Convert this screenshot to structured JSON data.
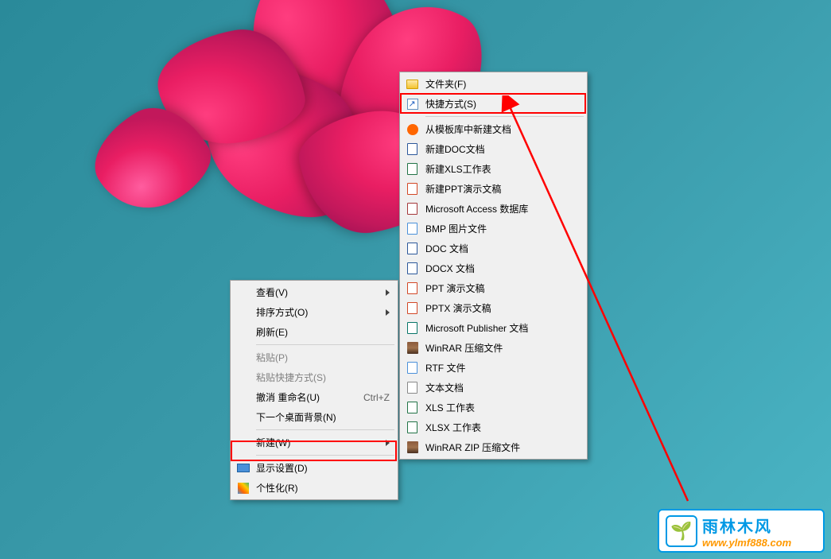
{
  "context_menu": {
    "view": "查看(V)",
    "sort": "排序方式(O)",
    "refresh": "刷新(E)",
    "paste": "粘贴(P)",
    "paste_shortcut": "粘贴快捷方式(S)",
    "undo": "撤消 重命名(U)",
    "undo_key": "Ctrl+Z",
    "next_bg": "下一个桌面背景(N)",
    "new": "新建(W)",
    "display": "显示设置(D)",
    "personalize": "个性化(R)"
  },
  "new_submenu": {
    "folder": "文件夹(F)",
    "shortcut": "快捷方式(S)",
    "template": "从模板库中新建文档",
    "doc": "新建DOC文档",
    "xls": "新建XLS工作表",
    "ppt": "新建PPT演示文稿",
    "access": "Microsoft Access 数据库",
    "bmp": "BMP 图片文件",
    "doc2": "DOC 文档",
    "docx": "DOCX 文档",
    "ppt2": "PPT 演示文稿",
    "pptx": "PPTX 演示文稿",
    "publisher": "Microsoft Publisher 文档",
    "winrar": "WinRAR 压缩文件",
    "rtf": "RTF 文件",
    "txt": "文本文档",
    "xls2": "XLS 工作表",
    "xlsx": "XLSX 工作表",
    "zip": "WinRAR ZIP 压缩文件"
  },
  "watermark": {
    "logo": "🌱",
    "title": "雨林木风",
    "url": "www.ylmf888.com"
  }
}
